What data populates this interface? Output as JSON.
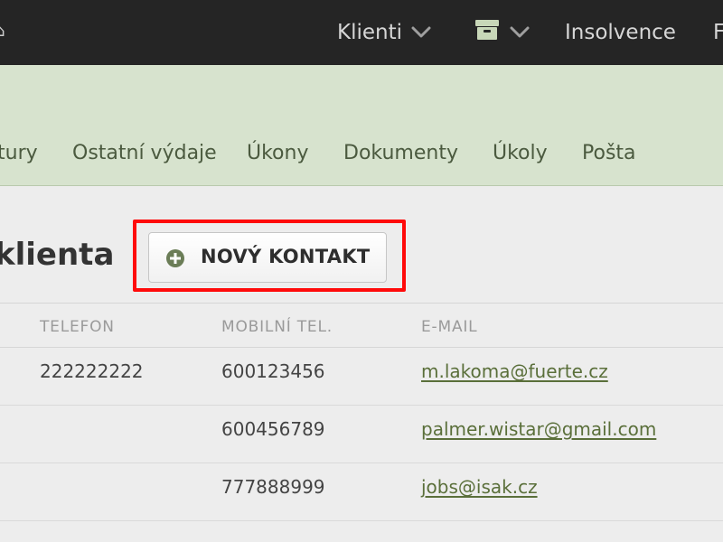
{
  "topnav": {
    "clients_label": "Klienti",
    "insolvency_label": "Insolvence",
    "cut_label": "F",
    "icons": {
      "clients_dropdown": "chevron-down-icon",
      "archive": "archive-box-icon",
      "archive_dropdown": "chevron-down-icon"
    }
  },
  "subnav": {
    "items": [
      "tury",
      "Ostatní výdaje",
      "Úkony",
      "Dokumenty",
      "Úkoly",
      "Pošta"
    ]
  },
  "page": {
    "title": "klienta"
  },
  "toolbar": {
    "new_contact_label": "NOVÝ KONTAKT",
    "new_contact_icon": "plus-circle-icon"
  },
  "table": {
    "columns": [
      "TELEFON",
      "MOBILNÍ TEL.",
      "E-MAIL"
    ],
    "rows": [
      {
        "phone": "222222222",
        "mobile": "600123456",
        "email": "m.lakoma@fuerte.cz"
      },
      {
        "phone": "",
        "mobile": "600456789",
        "email": "palmer.wistar@gmail.com"
      },
      {
        "phone": "",
        "mobile": "777888999",
        "email": "jobs@isak.cz"
      }
    ]
  },
  "colors": {
    "topbar_bg": "#252525",
    "green_band": "#d7e3ce",
    "link_green": "#5a6f3a",
    "highlight_red": "#ff0a0a",
    "plus_icon": "#6b7d57"
  }
}
